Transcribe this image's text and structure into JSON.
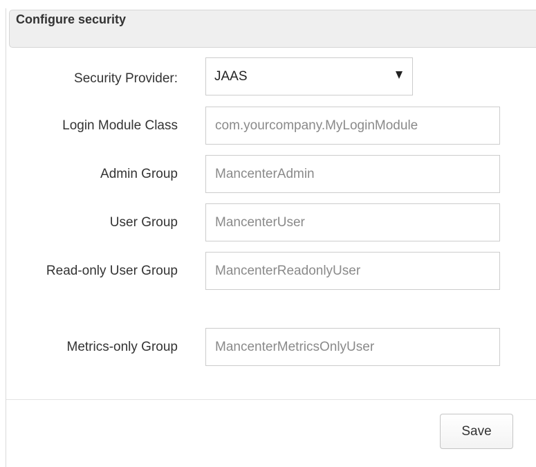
{
  "panel": {
    "title": "Configure security"
  },
  "form": {
    "security_provider": {
      "label": "Security Provider:",
      "selected": "JAAS"
    },
    "login_module_class": {
      "label": "Login Module Class",
      "placeholder": "com.yourcompany.MyLoginModule"
    },
    "admin_group": {
      "label": "Admin Group",
      "placeholder": "MancenterAdmin"
    },
    "user_group": {
      "label": "User Group",
      "placeholder": "MancenterUser"
    },
    "readonly_user_group": {
      "label": "Read-only User Group",
      "placeholder": "MancenterReadonlyUser"
    },
    "metrics_only_group": {
      "label": "Metrics-only Group",
      "placeholder": "MancenterMetricsOnlyUser"
    }
  },
  "footer": {
    "save_label": "Save"
  },
  "icons": {
    "select_arrow": "triangle-down-icon"
  }
}
